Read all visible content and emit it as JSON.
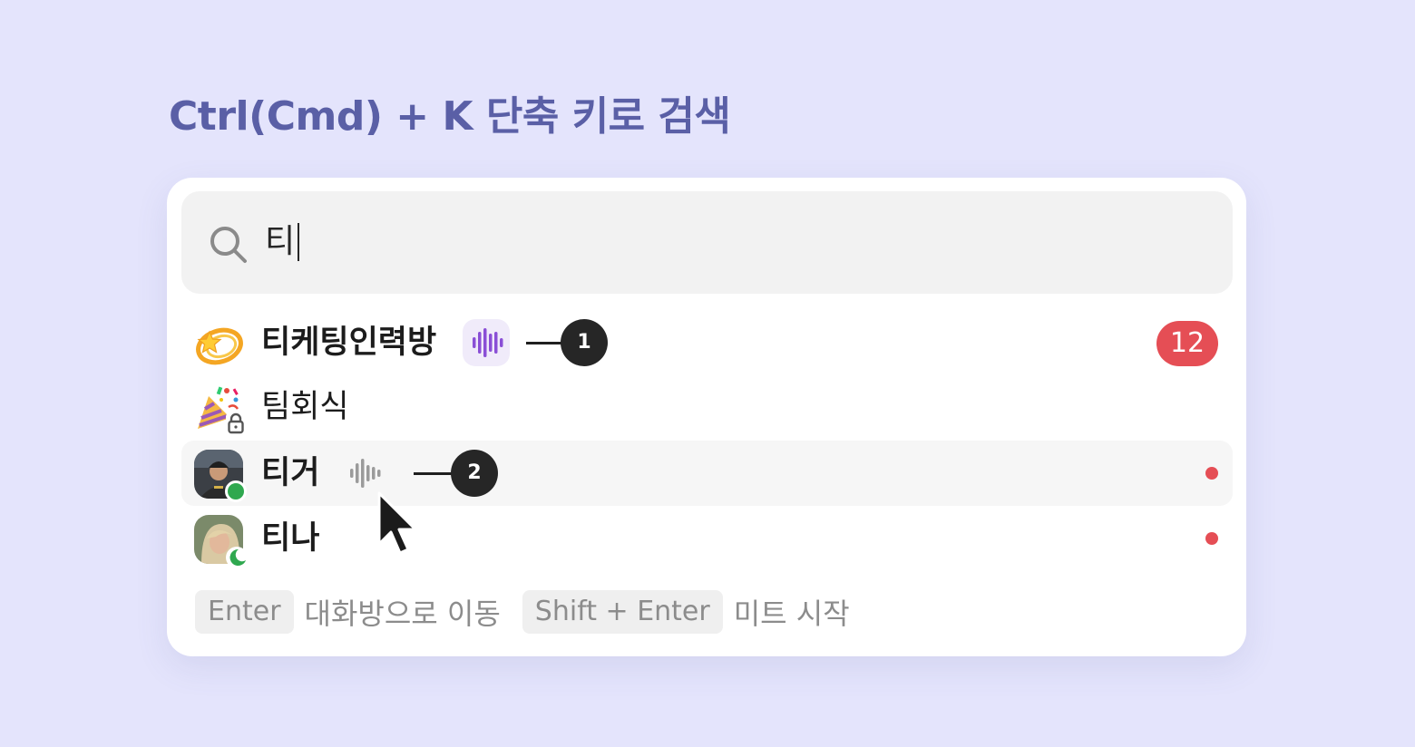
{
  "heading": "Ctrl(Cmd) + K 단축 키로 검색",
  "search": {
    "icon": "search-icon",
    "value": "티"
  },
  "results": [
    {
      "label": "티케팅인력방",
      "emoji": "💫",
      "bold": true,
      "huddle_active": true,
      "callout": "1",
      "unread_count": "12"
    },
    {
      "label": "팀회식",
      "emoji": "🎉",
      "bold": false,
      "private": true
    },
    {
      "label": "티거",
      "bold": true,
      "avatar": "user-photo",
      "presence": "online",
      "huddle_active": false,
      "callout": "2",
      "unread_dot": true,
      "highlighted": true
    },
    {
      "label": "티나",
      "bold": true,
      "avatar": "user-photo",
      "presence": "away",
      "unread_dot": true
    }
  ],
  "footer": {
    "enter_key": "Enter",
    "enter_hint": "대화방으로 이동",
    "shift_enter_key": "Shift + Enter",
    "shift_enter_hint": "미트 시작"
  },
  "colors": {
    "background": "#e4e4fc",
    "heading": "#5a5fa6",
    "badge": "#e54e55",
    "huddle_active": "#8a4fd6",
    "huddle_inactive": "#9b9b9b",
    "online": "#2fa84f"
  }
}
